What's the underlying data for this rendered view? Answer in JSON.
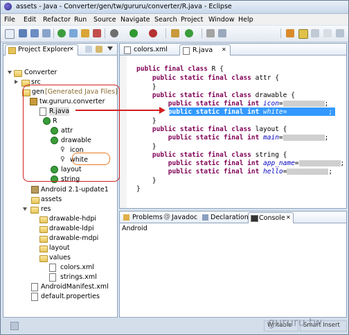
{
  "window": {
    "title": "assets - Java - Converter/gen/tw/gururu/converter/R.java - Eclipse"
  },
  "menu": [
    "File",
    "Edit",
    "Refactor",
    "Run",
    "Source",
    "Navigate",
    "Search",
    "Project",
    "Window",
    "Help"
  ],
  "explorer": {
    "title": "Project Explorer",
    "close_glyph": "✕",
    "items": {
      "converter": "Converter",
      "src": "src",
      "gen": "gen",
      "gen_note": "[Generated Java Files]",
      "package": "tw.gururu.converter",
      "rjava": "R.java",
      "r": "R",
      "attr": "attr",
      "drawable": "drawable",
      "icon": "icon",
      "white": "white",
      "layout": "layout",
      "string": "string",
      "android": "Android 2.1-update1",
      "assets": "assets",
      "res": "res",
      "dhdpi": "drawable-hdpi",
      "dldpi": "drawable-ldpi",
      "dmdpi": "drawable-mdpi",
      "layout_folder": "layout",
      "values": "values",
      "colors": "colors.xml",
      "strings": "strings.xml",
      "manifest": "AndroidManifest.xml",
      "default_props": "default.properties"
    }
  },
  "editor": {
    "tabs": [
      "colors.xml",
      "R.java"
    ],
    "close_glyph": "✕",
    "lines": {
      "l1": "public final class R {",
      "l2": "    public static final class attr {",
      "l3": "    }",
      "l4": "    public static final class drawable {",
      "l5a": "        public static final int ",
      "l5b": "icon",
      "l5c": "=",
      "l5d": ";",
      "l6a": "        public static final int ",
      "l6b": "white",
      "l6c": "=",
      "l6d": ";",
      "l7": "    }",
      "l8": "    public static final class layout {",
      "l9a": "        public static final int ",
      "l9b": "main",
      "l9c": "=",
      "l9d": ";",
      "l10": "    }",
      "l11": "    public static final class string {",
      "l12a": "        public static final int ",
      "l12b": "app_name",
      "l12c": "=",
      "l12d": ";",
      "l13a": "        public static final int ",
      "l13b": "hello",
      "l13c": "=",
      "l13d": ";",
      "l14": "    }",
      "l15": "}"
    }
  },
  "bottom": {
    "tabs": [
      "Problems",
      "Javadoc",
      "Declaration",
      "Console"
    ],
    "close_glyph": "✕",
    "console_label": "Android"
  },
  "status": {
    "writable": "Writable",
    "insert": "Smart Insert"
  },
  "watermark": "gururu.tw",
  "colors": {
    "keyword": "#7f0055",
    "field": "#0000c0",
    "selection": "#3399ff",
    "annotation_red": "#d32020",
    "annotation_orange": "#ea7a22"
  }
}
